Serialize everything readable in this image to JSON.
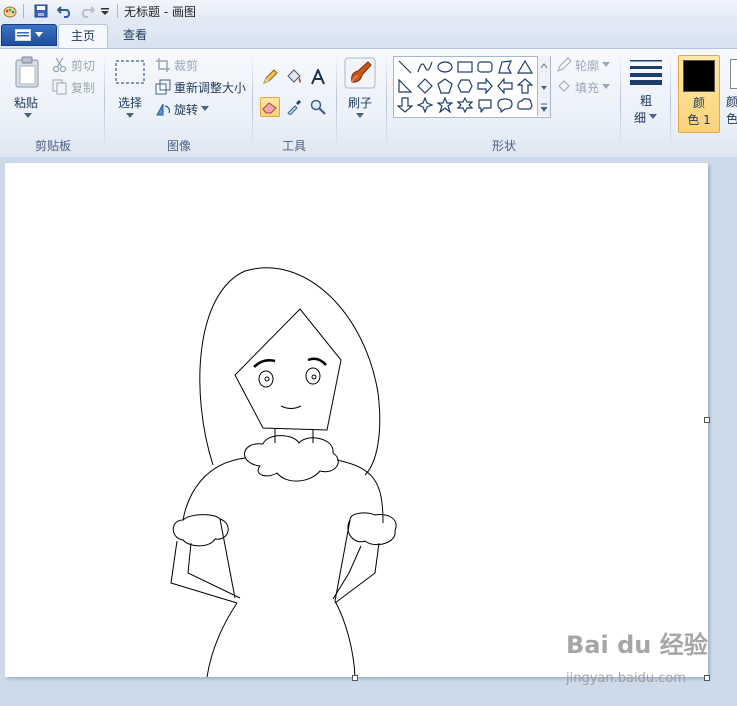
{
  "window": {
    "title": "无标题 - 画图"
  },
  "tabs": {
    "home": "主页",
    "view": "查看"
  },
  "ribbon": {
    "clipboard": {
      "paste": "粘贴",
      "cut": "剪切",
      "copy": "复制",
      "group": "剪贴板"
    },
    "image": {
      "select": "选择",
      "crop": "裁剪",
      "resize": "重新调整大小",
      "rotate": "旋转",
      "group": "图像"
    },
    "tools": {
      "group": "工具"
    },
    "brushes": {
      "label": "刷子"
    },
    "shapes": {
      "outline": "轮廓",
      "fill": "填充",
      "group": "形状"
    },
    "size": {
      "label_line1": "粗",
      "label_line2": "细"
    },
    "colors": {
      "color1_line1": "颜",
      "color1_line2": "色 1",
      "color1_value": "#000000",
      "color2_line1": "颜",
      "color2_line2": "色"
    }
  },
  "watermark": {
    "text": "Bai du 经验",
    "sub": "jingyan.baidu.com"
  }
}
